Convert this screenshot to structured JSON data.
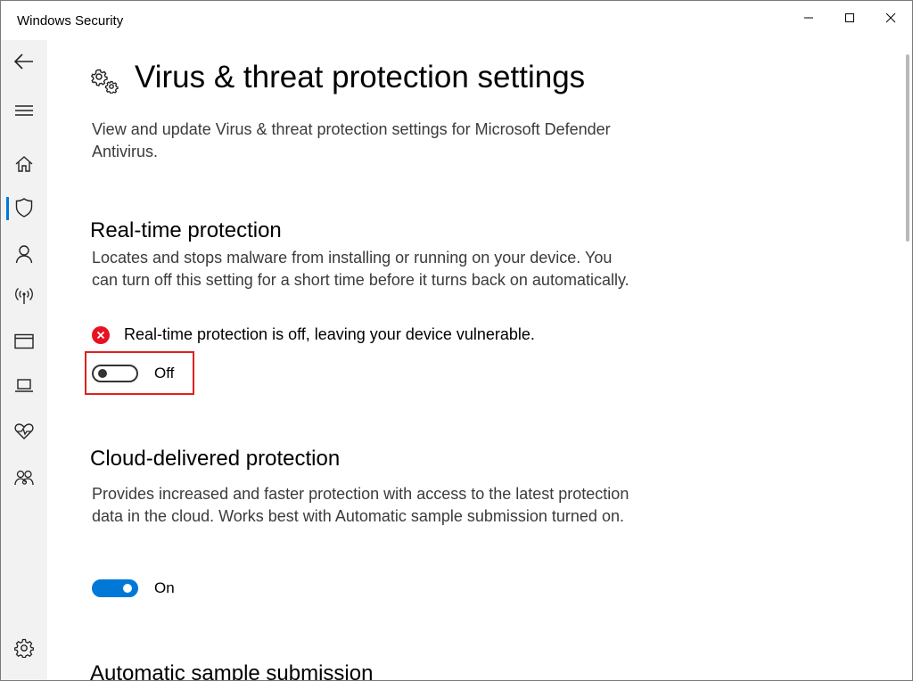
{
  "window": {
    "title": "Windows Security",
    "controls": [
      "minimize",
      "maximize",
      "close"
    ]
  },
  "sidebar": {
    "items": [
      {
        "name": "back",
        "icon": "back-arrow-icon"
      },
      {
        "name": "menu",
        "icon": "hamburger-icon"
      },
      {
        "name": "home",
        "icon": "home-icon"
      },
      {
        "name": "virus-protection",
        "icon": "shield-icon",
        "active": true
      },
      {
        "name": "account-protection",
        "icon": "person-icon"
      },
      {
        "name": "firewall",
        "icon": "wifi-antenna-icon"
      },
      {
        "name": "app-browser-control",
        "icon": "browser-window-icon"
      },
      {
        "name": "device-security",
        "icon": "laptop-icon"
      },
      {
        "name": "device-performance",
        "icon": "heart-pulse-icon"
      },
      {
        "name": "family-options",
        "icon": "family-icon"
      },
      {
        "name": "settings",
        "icon": "gear-icon"
      }
    ]
  },
  "page": {
    "title": "Virus & threat protection settings",
    "description": "View and update Virus & threat protection settings for Microsoft Defender Antivirus."
  },
  "realtime": {
    "title": "Real-time protection",
    "description": "Locates and stops malware from installing or running on your device. You can turn off this setting for a short time before it turns back on automatically.",
    "warning": "Real-time protection is off, leaving your device vulnerable.",
    "toggle_label": "Off",
    "toggle_state": false
  },
  "cloud": {
    "title": "Cloud-delivered protection",
    "description": "Provides increased and faster protection with access to the latest protection data in the cloud. Works best with Automatic sample submission turned on.",
    "toggle_label": "On",
    "toggle_state": true
  },
  "sample": {
    "title": "Automatic sample submission"
  },
  "colors": {
    "accent": "#0078d7",
    "error": "#e81123",
    "highlight": "#e02020"
  }
}
